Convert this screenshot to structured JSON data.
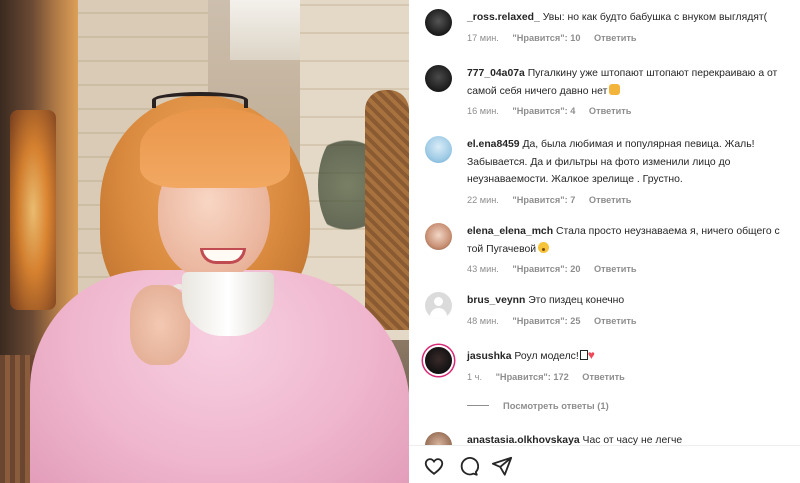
{
  "post": {
    "photo_alt": "photo"
  },
  "comments": [
    {
      "username": "_ross.relaxed_",
      "text": "Увы: но как будто бабушка с внуком выглядят(",
      "time": "17 мин.",
      "likes": "\"Нравится\": 10",
      "reply": "Ответить",
      "avatar_icon": "avatar-dark"
    },
    {
      "username": "777_04a07a",
      "text": "Пугалкину уже штопают штопают перекраиваю а от самой себя ничего давно нет",
      "emoji": "hand-emoji",
      "time": "16 мин.",
      "likes": "\"Нравится\": 4",
      "reply": "Ответить",
      "avatar_icon": "avatar-dark"
    },
    {
      "username": "el.ena8459",
      "text": "Да, была любимая и популярная певица. Жаль! Забывается. Да и фильтры на фото изменили лицо до неузнаваемости. Жалкое зрелище . Грустно.",
      "time": "22 мин.",
      "likes": "\"Нравится\": 7",
      "reply": "Ответить",
      "avatar_icon": "avatar-light"
    },
    {
      "username": "elena_elena_mch",
      "text": "Стала просто неузнаваема я, ничего общего с той Пугачевой",
      "emoji": "surprised-face-emoji",
      "time": "43 мин.",
      "likes": "\"Нравится\": 20",
      "reply": "Ответить",
      "avatar_icon": "avatar-photo"
    },
    {
      "username": "brus_veynn",
      "text": "Это пиздец конечно",
      "time": "48 мин.",
      "likes": "\"Нравится\": 25",
      "reply": "Ответить",
      "avatar_icon": "default-avatar"
    },
    {
      "username": "jasushka",
      "text": "Роул моделс!",
      "emoji": "heart-emoji",
      "time": "1 ч.",
      "likes": "\"Нравится\": 172",
      "reply": "Ответить",
      "avatar_icon": "avatar-story-ring"
    },
    {
      "username": "anastasia.olkhovskaya",
      "text": "Час от часу не легче",
      "avatar_icon": "avatar-photo"
    }
  ],
  "view_replies": "Посмотреть ответы (1)",
  "actions": {
    "like_icon": "heart-outline-icon",
    "comment_icon": "comment-bubble-icon",
    "share_icon": "paper-plane-icon"
  },
  "colors": {
    "text": "#262626",
    "muted": "#8e8e8e",
    "heart": "#ed4956",
    "story_ring": "#d62976"
  }
}
